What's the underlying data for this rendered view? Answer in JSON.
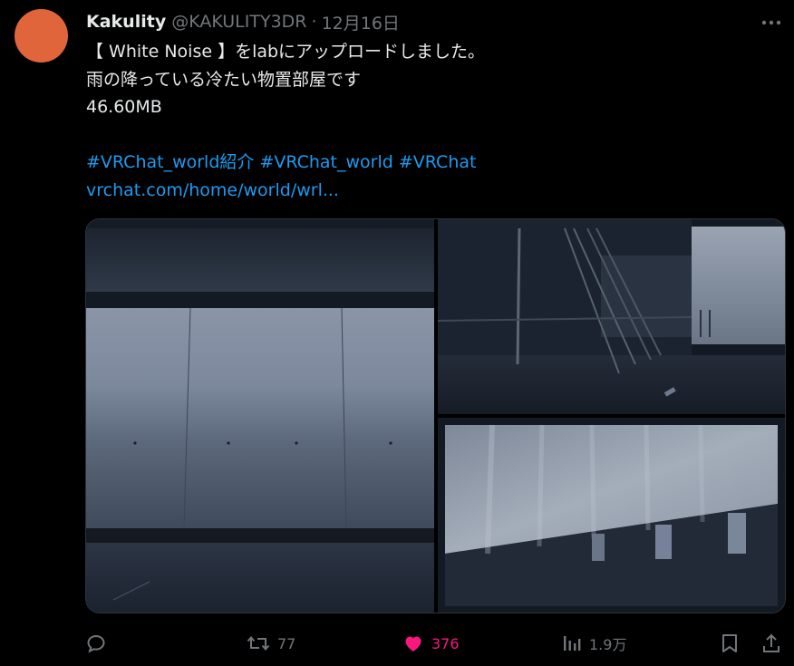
{
  "author": {
    "display_name": "Kakulity",
    "handle": "@KAKULITY3DR",
    "separator": "·",
    "date": "12月16日",
    "avatar_color": "#e0653a"
  },
  "tweet": {
    "line1": "【 White Noise 】をlabにアップロードしました。",
    "line2": "雨の降っている冷たい物置部屋です",
    "line3": "46.60MB",
    "hashtags": [
      "#VRChat_world紹介",
      "#VRChat_world",
      "#VRChat"
    ],
    "link": "vrchat.com/home/world/wrl..."
  },
  "media": {
    "count": 3,
    "icons": [
      "image-wide-window",
      "image-railing",
      "image-curtain"
    ]
  },
  "actions": {
    "reply_count": "",
    "retweet_count": "77",
    "like_count": "376",
    "views_count": "1.9万",
    "like_color": "#f91880",
    "muted_color": "#71767b",
    "link_color": "#1d9bf0"
  }
}
